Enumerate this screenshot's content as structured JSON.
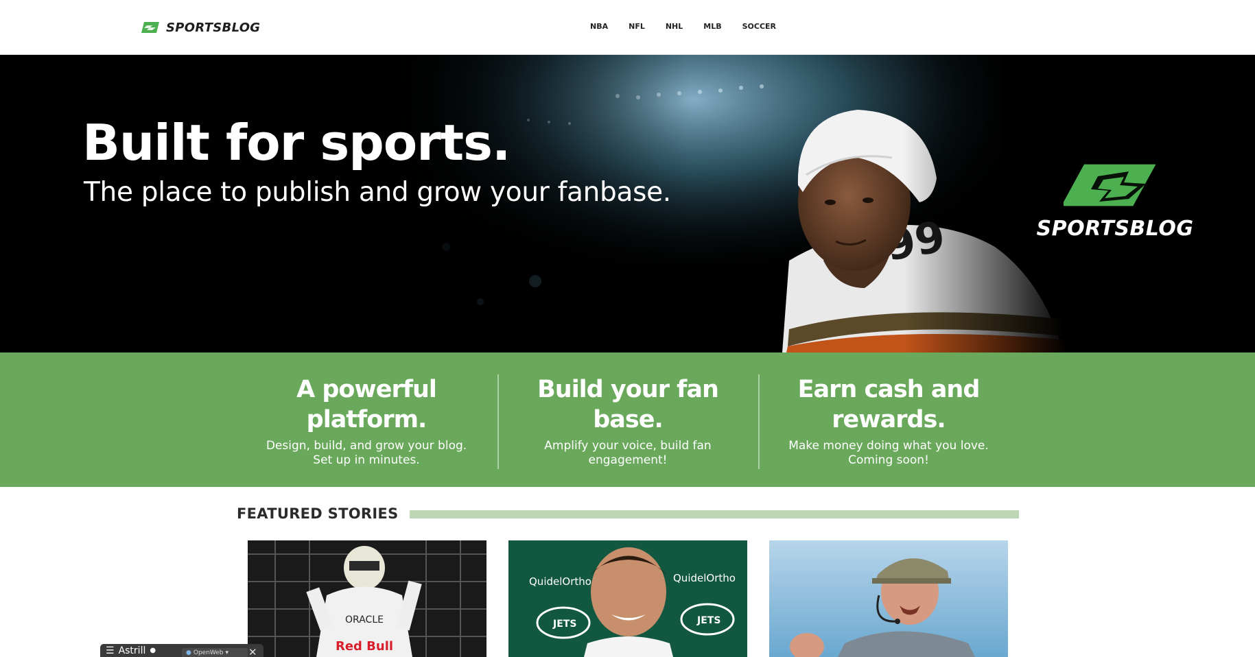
{
  "header": {
    "logo_text": "SPORTSBLOG",
    "nav": [
      "NBA",
      "NFL",
      "NHL",
      "MLB",
      "SOCCER"
    ]
  },
  "hero": {
    "title": "Built for sports.",
    "subtitle": "The place to publish and grow your fanbase.",
    "logo_text": "SPORTSBLOG",
    "jersey_number": "99"
  },
  "features": [
    {
      "title_line1": "A powerful",
      "title_line2": "platform.",
      "desc_line1": "Design, build, and grow your blog.",
      "desc_line2": "Set up in minutes."
    },
    {
      "title_line1": "Build your fan",
      "title_line2": "base.",
      "desc_line1": "Amplify your voice, build fan",
      "desc_line2": "engagement!"
    },
    {
      "title_line1": "Earn cash and",
      "title_line2": "rewards.",
      "desc_line1": "Make money doing what you love.",
      "desc_line2": "Coming soon!"
    }
  ],
  "featured": {
    "heading": "FEATURED STORIES",
    "stories": [
      {
        "image": "racing-driver-photo",
        "text1": "ORACLE",
        "text2": "Red Bull"
      },
      {
        "image": "jets-press-conference-photo",
        "text1": "QuidelOrtho",
        "text2": "JETS"
      },
      {
        "image": "coach-sideline-photo"
      }
    ]
  },
  "widgets": {
    "astrill": "Astrill",
    "openweb": "OpenWeb"
  },
  "colors": {
    "brand_green": "#6aa95c",
    "logo_green": "#4caf50",
    "accent_line": "#bdd7b4"
  }
}
